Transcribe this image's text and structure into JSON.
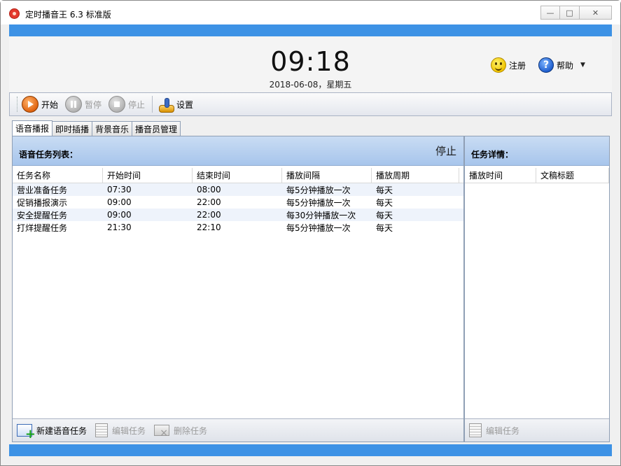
{
  "window": {
    "title": "定时播音王 6.3 标准版"
  },
  "header": {
    "time": "09:18",
    "date": "2018-06-08，星期五",
    "register_label": "注册",
    "help_label": "帮助"
  },
  "toolbar": {
    "start_label": "开始",
    "pause_label": "暂停",
    "stop_label": "停止",
    "settings_label": "设置"
  },
  "tabs": [
    {
      "label": "语音播报",
      "active": true
    },
    {
      "label": "即时插播",
      "active": false
    },
    {
      "label": "背景音乐",
      "active": false
    },
    {
      "label": "播音员管理",
      "active": false
    }
  ],
  "task_list": {
    "title": "语音任务列表：",
    "status": "停止",
    "columns": [
      "任务名称",
      "开始时间",
      "结束时间",
      "播放间隔",
      "播放周期"
    ],
    "rows": [
      [
        "营业准备任务",
        "07:30",
        "08:00",
        "每5分钟播放一次",
        "每天"
      ],
      [
        "促销播报演示",
        "09:00",
        "22:00",
        "每5分钟播放一次",
        "每天"
      ],
      [
        "安全提醒任务",
        "09:00",
        "22:00",
        "每30分钟播放一次",
        "每天"
      ],
      [
        "打烊提醒任务",
        "21:30",
        "22:10",
        "每5分钟播放一次",
        "每天"
      ]
    ],
    "footer": {
      "new_label": "新建语音任务",
      "edit_label": "编辑任务",
      "delete_label": "删除任务"
    }
  },
  "task_detail": {
    "title": "任务详情：",
    "columns": [
      "播放时间",
      "文稿标题"
    ],
    "footer": {
      "edit_label": "编辑任务"
    }
  },
  "colors": {
    "accent_strip": "#3d92e5",
    "panel_header": "#a7c5ec"
  }
}
